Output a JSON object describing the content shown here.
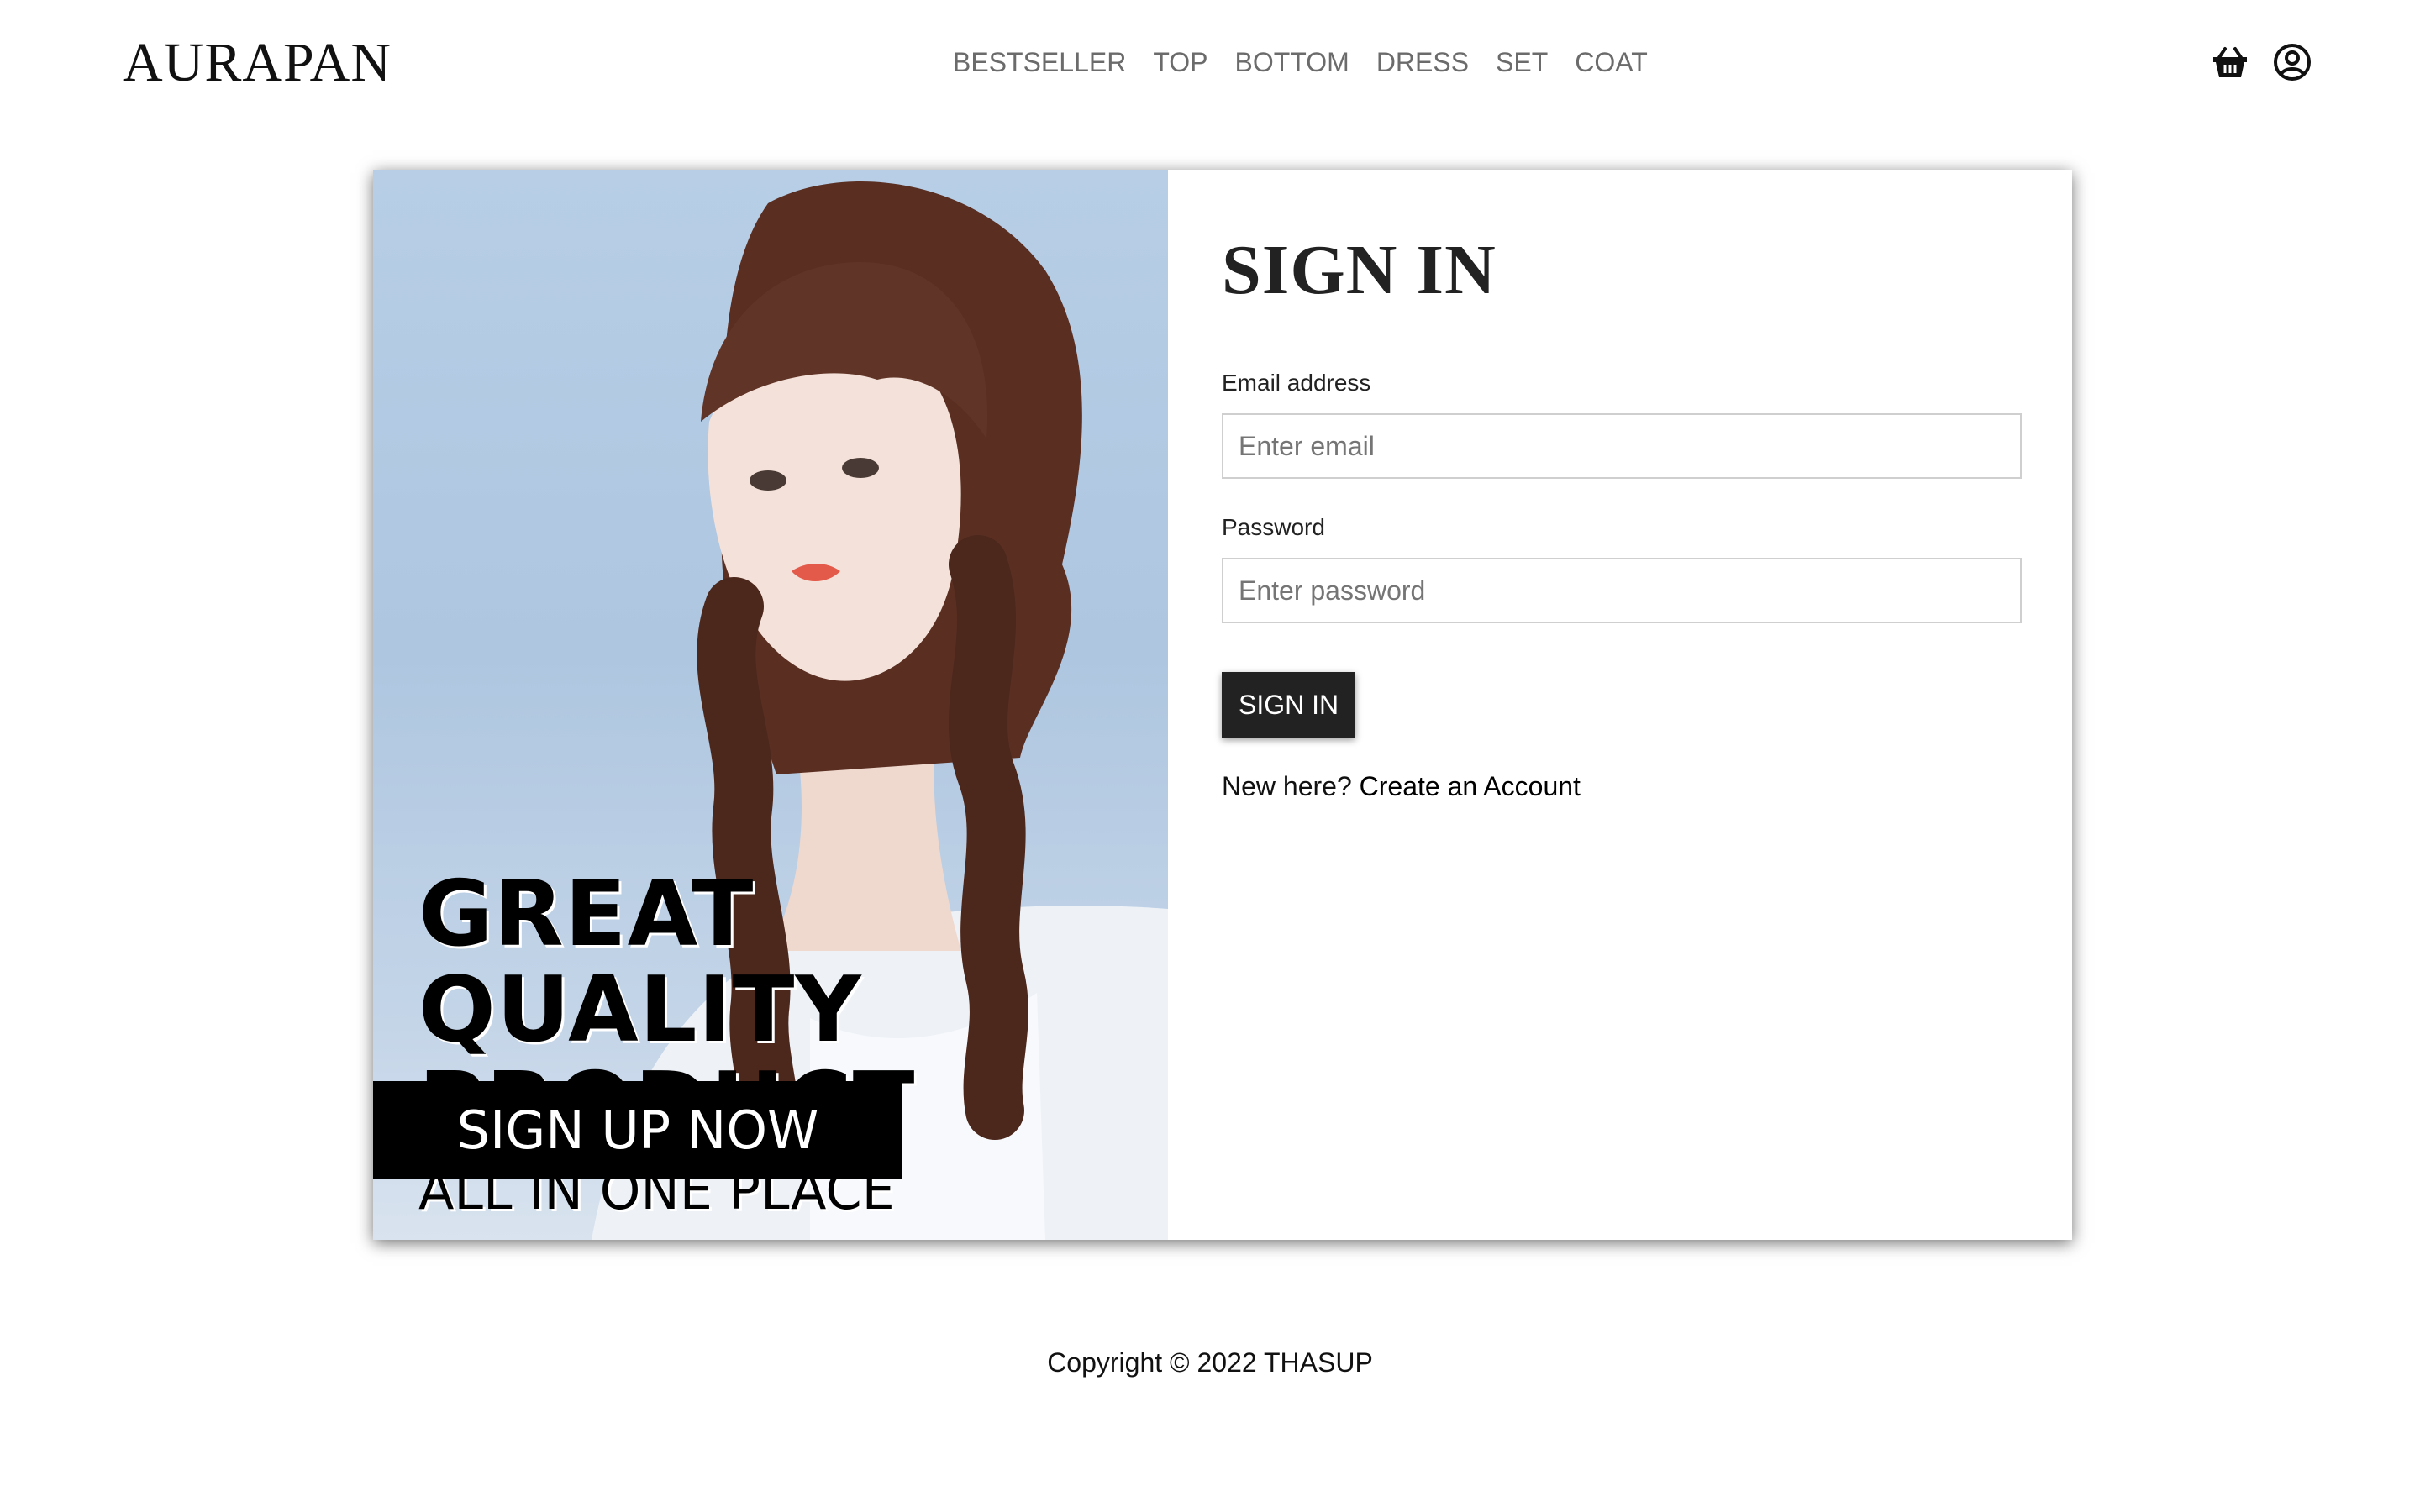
{
  "brand": {
    "logo": "AURAPAN"
  },
  "nav": {
    "items": [
      "BESTSELLER",
      "TOP",
      "BOTTOM",
      "DRESS",
      "SET",
      "COAT"
    ]
  },
  "header_icons": [
    "basket-icon",
    "user-circle-icon"
  ],
  "promo": {
    "lines": [
      "GREAT",
      "QUALITY",
      "PRODUCT"
    ],
    "subline": "ALL IN ONE PLACE",
    "cta": "SIGN UP NOW"
  },
  "form": {
    "title": "SIGN IN",
    "email_label": "Email address",
    "email_placeholder": "Enter email",
    "email_value": "",
    "password_label": "Password",
    "password_placeholder": "Enter password",
    "password_value": "",
    "submit_label": "SIGN IN",
    "new_here": "New here?",
    "create_link": "Create an Account"
  },
  "footer": {
    "copyright": "Copyright © 2022  THASUP"
  },
  "colors": {
    "nav_text": "#6b6b6b",
    "button_bg": "#222222",
    "promo_bg": "#b7cee6",
    "banner_bg": "#000000"
  }
}
